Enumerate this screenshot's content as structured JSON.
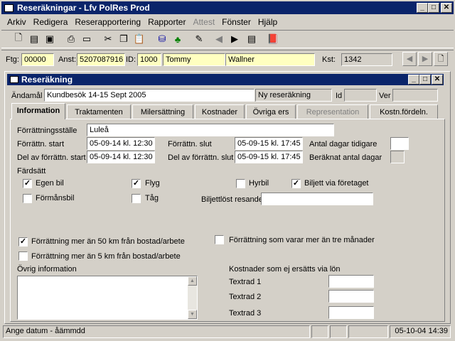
{
  "app": {
    "title": "Reseräkningar - Lfv PolRes Prod"
  },
  "menu": [
    "Arkiv",
    "Redigera",
    "Reserapportering",
    "Rapporter",
    "Attest",
    "Fönster",
    "Hjälp"
  ],
  "toolbar": {
    "icons": [
      "new-icon",
      "open-icon",
      "save-icon",
      "print-icon",
      "preview-icon",
      "cut-icon",
      "copy-icon",
      "paste-icon",
      "filter-icon",
      "tree-icon",
      "edit-icon",
      "prev-icon",
      "next-icon",
      "list-icon",
      "book-icon"
    ]
  },
  "header": {
    "ftg_label": "Ftg:",
    "ftg_value": "00000",
    "anst_label": "Anst:",
    "anst_value": "5207087916",
    "id_label": "ID:",
    "id_value": "1000",
    "first_name": "Tommy",
    "last_name": "Wallner",
    "kst_label": "Kst:",
    "kst_value": "1342"
  },
  "child": {
    "title": "Reseräkning"
  },
  "form": {
    "andamal_label": "Ändamål",
    "andamal_value": "Kundbesök 14-15 Sept 2005",
    "ny_label": "Ny reseräkning",
    "id_label": "Id",
    "ver_label": "Ver"
  },
  "tabs": [
    "Information",
    "Traktamenten",
    "Milersättning",
    "Kostnader",
    "Övriga ers",
    "Representation",
    "Kostn.fördeln."
  ],
  "info": {
    "forrattningsstalle_label": "Förrättningsställe",
    "forrattningsstalle_value": "Luleå",
    "start_label": "Förrättn. start",
    "start_value": "05-09-14  kl. 12:30",
    "slut_label": "Förrättn. slut",
    "slut_value": "05-09-15  kl. 17:45",
    "antal_tidigare_label": "Antal dagar tidigare",
    "del_start_label": "Del av förrättn. start",
    "del_start_value": "05-09-14  kl. 12:30",
    "del_slut_label": "Del av förrättn. slut",
    "del_slut_value": "05-09-15  kl. 17:45",
    "beraknat_label": "Beräknat antal dagar",
    "fardsatt_label": "Färdsätt",
    "egen_bil": "Egen bil",
    "flyg": "Flyg",
    "hyrbil": "Hyrbil",
    "biljett_via": "Biljett via företaget",
    "formansbil": "Förmånsbil",
    "tag": "Tåg",
    "biljettlost_label": "Biljettlöst resande",
    "over50": "Förrättning mer än 50 km från bostad/arbete",
    "tre_man": "Förrättning som varar mer än tre månader",
    "over5": "Förrättning mer än 5 km från bostad/arbete",
    "ovrig_label": "Övrig information",
    "kostnader_label": "Kostnader som ej ersätts via lön",
    "textrad1": "Textrad 1",
    "textrad2": "Textrad 2",
    "textrad3": "Textrad 3"
  },
  "checks": {
    "egen_bil": true,
    "flyg": true,
    "hyrbil": false,
    "biljett_via": true,
    "formansbil": false,
    "tag": false,
    "over50": true,
    "tre_man": false,
    "over5": false
  },
  "status": {
    "hint": "Ange datum - åämmdd",
    "datetime": "05-10-04 14:39"
  }
}
